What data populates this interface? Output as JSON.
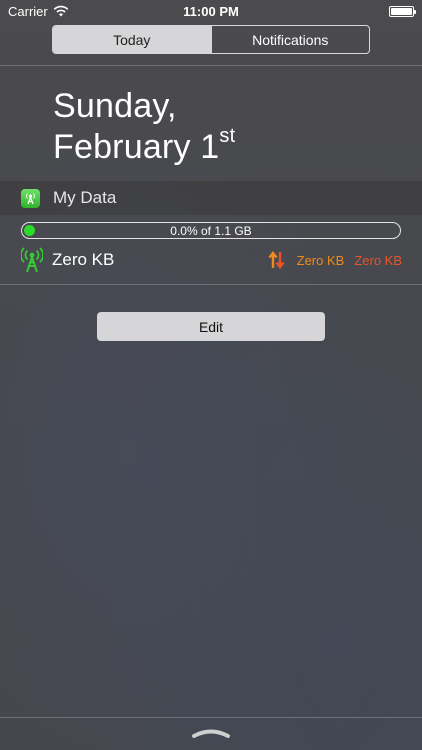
{
  "status_bar": {
    "carrier": "Carrier",
    "time": "11:00 PM",
    "battery_level": 1.0
  },
  "segmented_control": {
    "tabs": [
      {
        "label": "Today",
        "active": true
      },
      {
        "label": "Notifications",
        "active": false
      }
    ]
  },
  "date": {
    "line1": "Sunday,",
    "line2_main": "February 1",
    "line2_suffix": "st"
  },
  "widget": {
    "title": "My Data",
    "icon": "antenna-app-icon",
    "progress_text": "0.0% of 1.1 GB",
    "progress_fraction": 0.0,
    "total_usage": "Zero KB",
    "upload": "Zero KB",
    "download": "Zero KB",
    "colors": {
      "progress_dot": "#2bdd2b",
      "upload": "#f08a1c",
      "download": "#e8542a",
      "antenna": "#36c936"
    }
  },
  "edit_button": {
    "label": "Edit"
  },
  "icons": [
    "wifi-icon",
    "battery-icon",
    "antenna-icon",
    "updown-arrows-icon",
    "chevron-handle-icon"
  ]
}
